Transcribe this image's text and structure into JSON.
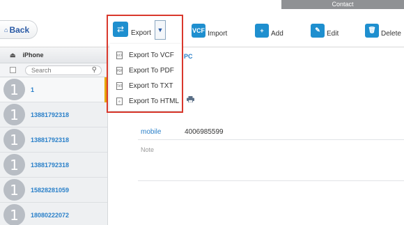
{
  "top_tab": {
    "label": "Contact"
  },
  "toolbar": {
    "back_label": "Back",
    "export_label": "Export",
    "import_label": "Import",
    "add_label": "Add",
    "edit_label": "Edit",
    "delete_label": "Delete"
  },
  "export_menu": {
    "items": [
      {
        "label": "Export To VCF",
        "icon": "vcf-file-icon",
        "badge": "VCF"
      },
      {
        "label": "Export To PDF",
        "icon": "pdf-file-icon",
        "badge": "PDF"
      },
      {
        "label": "Export To TXT",
        "icon": "txt-file-icon",
        "badge": "TXT"
      },
      {
        "label": "Export To HTML",
        "icon": "html-file-icon",
        "badge": "e"
      }
    ]
  },
  "sidebar": {
    "device_name": "iPhone",
    "search_placeholder": "Search",
    "contacts": [
      {
        "avatar": "1",
        "name": "1",
        "active": true
      },
      {
        "avatar": "1",
        "name": "13881792318"
      },
      {
        "avatar": "1",
        "name": "13881792318"
      },
      {
        "avatar": "1",
        "name": "13881792318"
      },
      {
        "avatar": "1",
        "name": "15828281059"
      },
      {
        "avatar": "1",
        "name": "18080222072"
      }
    ]
  },
  "detail": {
    "partial_label": "PC",
    "mobile_label": "mobile",
    "mobile_value": "4006985599",
    "note_label": "Note"
  },
  "colors": {
    "accent_blue": "#2a80c9",
    "toolbar_icon_blue": "#1e8fcf",
    "highlight_red": "#d9382c",
    "selected_marker": "#e7a600"
  }
}
